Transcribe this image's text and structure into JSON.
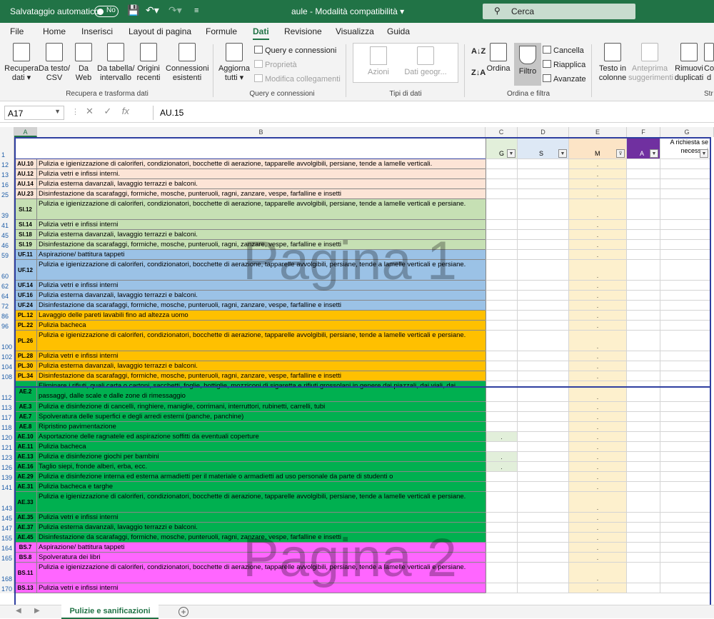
{
  "titlebar": {
    "autosave_label": "Salvataggio automatico",
    "autosave_state": "No",
    "doc_title": "aule  -  Modalità compatibilità  ▾",
    "search_placeholder": "Cerca"
  },
  "tabs": [
    "File",
    "Home",
    "Inserisci",
    "Layout di pagina",
    "Formule",
    "Dati",
    "Revisione",
    "Visualizza",
    "Guida"
  ],
  "active_tab": "Dati",
  "ribbon": {
    "recupera": "Recupera\ndati ▾",
    "datesto": "Da testo/\nCSV",
    "daweb": "Da\nWeb",
    "databella": "Da tabella/\nintervallo",
    "origini": "Origini\nrecenti",
    "connessioni": "Connessioni\nesistenti",
    "grp_recupera": "Recupera e trasforma dati",
    "aggiorna": "Aggiorna\ntutti ▾",
    "query_conn": "Query e connessioni",
    "proprieta": "Proprietà",
    "modifica_coll": "Modifica collegamenti",
    "grp_query": "Query e connessioni",
    "aziomi": "Azioni",
    "dati_geogr": "Dati geogr...",
    "grp_tipi": "Tipi di dati",
    "ordina": "Ordina",
    "filtro": "Filtro",
    "cancella": "Cancella",
    "riapplica": "Riapplica",
    "avanzate": "Avanzate",
    "grp_ordina": "Ordina e filtra",
    "testo_colonne": "Testo in\ncolonne",
    "anteprima": "Anteprima\nsuggerimenti",
    "rimuovi_dup": "Rimuovi\nduplicati",
    "co_label": "Co\nd",
    "grp_str": "Str"
  },
  "formula_bar": {
    "name_box": "A17",
    "fx_label": "fx",
    "content": "AU.15"
  },
  "columns": [
    "A",
    "B",
    "C",
    "D",
    "E",
    "F",
    "G"
  ],
  "header_row": {
    "row_num": "1",
    "c": "G",
    "d": "S",
    "e": "M",
    "f": "A",
    "g": "A richiesta se necessari"
  },
  "rows": [
    {
      "n": "12",
      "code": "AU.10",
      "text": "Pulizia e igienizzazione di caloriferi, condizionatori, bocchette di aerazione, tapparelle avvolgibili, persiane, tende a lamelle verticali.",
      "c": "",
      "e": "."
    },
    {
      "n": "13",
      "code": "AU.12",
      "text": "Pulizia vetri e infissi interni.",
      "c": "",
      "e": "."
    },
    {
      "n": "16",
      "code": "AU.14",
      "text": "Pulizia esterna davanzali, lavaggio terrazzi e balconi.",
      "c": "",
      "e": "."
    },
    {
      "n": "25",
      "code": "AU.23",
      "text": "Disinfestazione   da    scarafaggi,   formiche,   mosche, punteruoli, ragni, zanzare, vespe, farfalline e insetti",
      "c": "",
      "e": "."
    },
    {
      "n": "39",
      "code": "SI.12",
      "text": "Pulizia e igienizzazione di caloriferi, condizionatori, bocchette di aerazione, tapparelle avvolgibili, persiane, tende a lamelle verticali e persiane.",
      "c": "",
      "e": "."
    },
    {
      "n": "41",
      "code": "SI.14",
      "text": "Pulizia vetri e infissi interni",
      "c": "",
      "e": "."
    },
    {
      "n": "45",
      "code": "SI.18",
      "text": "Pulizia esterna davanzali, lavaggio terrazzi e balconi.",
      "c": "",
      "e": "."
    },
    {
      "n": "46",
      "code": "SI.19",
      "text": "Disinfestazione da scarafaggi, formiche, mosche, punteruoli, ragni, zanzare, vespe, farfalline e insetti",
      "c": "",
      "e": "."
    },
    {
      "n": "59",
      "code": "UF.11",
      "text": "Aspirazione/ battitura tappeti",
      "c": "",
      "e": "."
    },
    {
      "n": "60",
      "code": "UF.12",
      "text": "Pulizia e igienizzazione di caloriferi, condizionatori, bocchette di aerazione, tapparelle avvolgibili, persiane, tende a lamelle verticali e persiane.",
      "c": "",
      "e": "."
    },
    {
      "n": "62",
      "code": "UF.14",
      "text": "Pulizia vetri e infissi interni",
      "c": "",
      "e": "."
    },
    {
      "n": "64",
      "code": "UF.16",
      "text": "Pulizia esterna davanzali, lavaggio terrazzi e balconi.",
      "c": "",
      "e": "."
    },
    {
      "n": "72",
      "code": "UF.24",
      "text": "Disinfestazione   da    scarafaggi,    formiche,   mosche, punteruoli, ragni, zanzare, vespe, farfalline e insetti",
      "c": "",
      "e": "."
    },
    {
      "n": "86",
      "code": "PL.12",
      "text": "Lavaggio delle pareti lavabili fino ad altezza uomo",
      "c": "",
      "e": "."
    },
    {
      "n": "96",
      "code": "PL.22",
      "text": "Pulizia bacheca",
      "c": "",
      "e": "."
    },
    {
      "n": "100",
      "code": "PL.26",
      "text": "Pulizia e igienizzazione di caloriferi, condizionatori, bocchette di aerazione, tapparelle avvolgibili, persiane, tende a lamelle verticali e persiane.",
      "c": "",
      "e": "."
    },
    {
      "n": "102",
      "code": "PL.28",
      "text": "Pulizia vetri e infissi interni",
      "c": "",
      "e": "."
    },
    {
      "n": "104",
      "code": "PL.30",
      "text": "Pulizia esterna davanzali, lavaggio terrazzi e balconi.",
      "c": "",
      "e": "."
    },
    {
      "n": "108",
      "code": "PL.34",
      "text": "Disinfestazione   da    scarafaggi,    formiche,   mosche, punteruoli, ragni, zanzare, vespe, farfalline e insetti",
      "c": "",
      "e": "."
    },
    {
      "n": "112",
      "code": "AE.2",
      "text": "Eliminare i rifiuti, quali carta  o cartoni, sacchetti, foglie, bottiglie, mozziconi di sigaretta  e  rifiuti  grossolani  in  genere dai piazzali, dai viali, dai passaggi, dalle scale e dalle zone  di rimessaggio",
      "c": "",
      "e": "."
    },
    {
      "n": "113",
      "code": "AE.3",
      "text": "Pulizia e  disinfezione di cancelli, ringhiere, maniglie, corrimani, interruttori, rubinetti, carrelli, tubi",
      "c": "",
      "e": "."
    },
    {
      "n": "117",
      "code": "AE.7",
      "text": "Spolveratura  delle  superfici  e  degli  arredi esterni (panche, panchine)",
      "c": "",
      "e": "."
    },
    {
      "n": "118",
      "code": "AE.8",
      "text": "Ripristino pavimentazione",
      "c": "",
      "e": "."
    },
    {
      "n": "120",
      "code": "AE.10",
      "text": "Asportazione delle ragnatele ed aspirazione soffitti da eventuali coperture",
      "c": ".",
      "e": "."
    },
    {
      "n": "121",
      "code": "AE.11",
      "text": "Pulizia bacheca",
      "c": "",
      "e": "."
    },
    {
      "n": "123",
      "code": "AE.13",
      "text": "Pulizia e disinfezione giochi per bambini",
      "c": ".",
      "e": "."
    },
    {
      "n": "126",
      "code": "AE.16",
      "text": "Taglio siepi, fronde alberi, erba,  ecc.",
      "c": ".",
      "e": "."
    },
    {
      "n": "139",
      "code": "AE.29",
      "text": "Pulizia e disinfezione interna ed esterna armadietti per il materiale  o  armadietti  ad  uso  personale  da  parte   di studenti o",
      "c": "",
      "e": "."
    },
    {
      "n": "141",
      "code": "AE.31",
      "text": "Pulizia bacheca e targhe",
      "c": "",
      "e": "."
    },
    {
      "n": "143",
      "code": "AE.33",
      "text": "Pulizia e igienizzazione di caloriferi, condizionatori, bocchette di aerazione, tapparelle avvolgibili, persiane, tende a lamelle verticali e persiane.",
      "c": "",
      "e": "."
    },
    {
      "n": "145",
      "code": "AE.35",
      "text": "Pulizia vetri e infissi interni",
      "c": "",
      "e": "."
    },
    {
      "n": "147",
      "code": "AE.37",
      "text": "Pulizia esterna davanzali, lavaggio terrazzi e balconi.",
      "c": "",
      "e": "."
    },
    {
      "n": "155",
      "code": "AE.45",
      "text": "Disinfestazione   da    scarafaggi,    formiche,    mosche, punteruoli, ragni, zanzare, vespe, farfalline e insetti",
      "c": "",
      "e": "."
    },
    {
      "n": "164",
      "code": "BS.7",
      "text": "Aspirazione/ battitura tappeti",
      "c": "",
      "e": "."
    },
    {
      "n": "165",
      "code": "BS.8",
      "text": "Spolveratura dei libri",
      "c": "",
      "e": "."
    },
    {
      "n": "168",
      "code": "BS.11",
      "text": "Pulizia e igienizzazione di caloriferi, condizionatori, bocchette di aerazione, tapparelle avvolgibili, persiane, tende a lamelle verticali e persiane.",
      "c": "",
      "e": "."
    },
    {
      "n": "170",
      "code": "BS.13",
      "text": "Pulizia vetri e infissi interni",
      "c": "",
      "e": "."
    }
  ],
  "row_colors": {
    "au": "#fce4d6",
    "si": "#c6e0b4",
    "uf": "#9bc2e6",
    "pl": "#ffc000",
    "ae": "#00b050",
    "bs": "#ff66ff"
  },
  "watermarks": [
    "Pagina 1",
    "Pagina 2"
  ],
  "sheet_tab": "Pulizie e sanificazioni"
}
